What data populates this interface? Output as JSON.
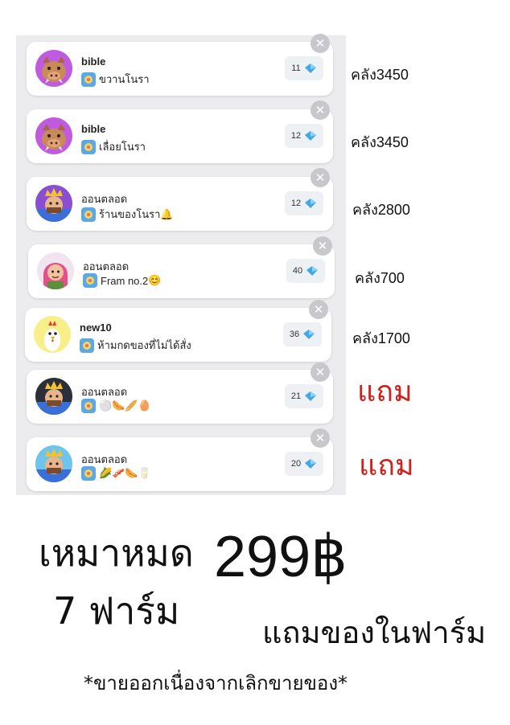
{
  "farms": [
    {
      "name": "bible",
      "subtitle": "ขวานโนรา",
      "emojis": "",
      "count": "11",
      "stock": "คลัง3450",
      "avatar": "pig-avatar-icon"
    },
    {
      "name": "bible",
      "subtitle": "เลื่อยโนรา",
      "emojis": "",
      "count": "12",
      "stock": "คลัง3450",
      "avatar": "pig-avatar-icon"
    },
    {
      "name": "ออนตลอด",
      "subtitle": "ร้านของโนรา",
      "emojis": "🔔",
      "count": "12",
      "stock": "คลัง2800",
      "avatar": "king-avatar-icon"
    },
    {
      "name": "ออนตลอด",
      "subtitle": "Fram no.2",
      "emojis": "😊",
      "count": "40",
      "stock": "คลัง700",
      "avatar": "archer-avatar-icon"
    },
    {
      "name": "new10",
      "subtitle": "ห้ามกดของที่ไม่ได้สั่ง",
      "emojis": "",
      "count": "36",
      "stock": "คลัง1700",
      "avatar": "chicken-avatar-icon"
    },
    {
      "name": "ออนตลอด",
      "subtitle": "",
      "emojis": "⚪🌭🥖🥚",
      "count": "21",
      "stock": "แถม",
      "avatar": "king-avatar-icon"
    },
    {
      "name": "ออนตลอด",
      "subtitle": "",
      "emojis": "🌽🥓🌭🥛",
      "count": "20",
      "stock": "แถม",
      "avatar": "king-avatar-icon"
    }
  ],
  "offer": {
    "line1": "เหมาหมด",
    "line2": "7 ฟาร์ม",
    "price": "299฿",
    "bonus": "แถมของในฟาร์ม",
    "note": "*ขายออกเนื่องจากเลิกขายของ*"
  },
  "colors": {
    "gift_red": "#d0201c",
    "panel_bg": "#ececee",
    "gem_blue": "#3fa9e8"
  }
}
